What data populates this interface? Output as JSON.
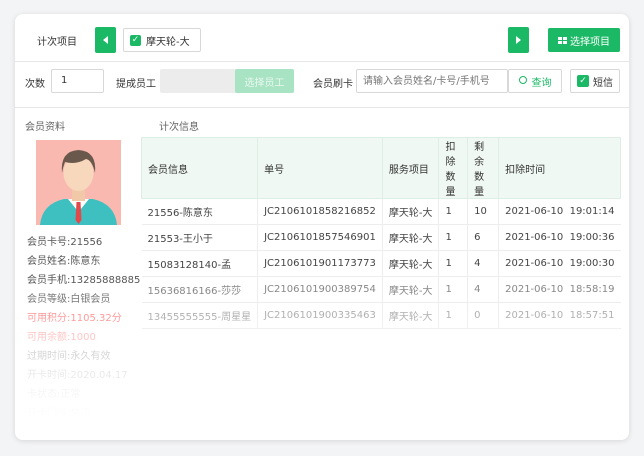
{
  "top": {
    "label": "计次项目",
    "selected_item": "摩天轮-大",
    "select_button": "选择项目"
  },
  "form": {
    "count_label": "次数",
    "count_value": "1",
    "staff_label": "提成员工",
    "staff_button": "选择员工",
    "card_label": "会员刷卡",
    "search_placeholder": "请输入会员姓名/卡号/手机号",
    "search_button": "查询",
    "sms_label": "短信"
  },
  "sections": {
    "member_title": "会员资料",
    "count_title": "计次信息"
  },
  "member": {
    "lines": [
      "会员卡号:21556",
      "会员姓名:陈意东",
      "会员手机:13285888885",
      "会员等级:白银会员",
      "可用积分:1105.32分",
      "可用余额:1000",
      "过期时间:永久有效",
      "开卡时间:2020.04.17",
      "卡状态:正常",
      "开卡门店:总店"
    ]
  },
  "table": {
    "headers": [
      "会员信息",
      "单号",
      "服务项目",
      "扣除数量",
      "剩余数量",
      "扣除时间"
    ],
    "rows": [
      [
        "21556-陈意东",
        "JC2106101858216852",
        "摩天轮-大",
        "1",
        "10",
        "2021-06-10  19:01:14"
      ],
      [
        "21553-王小于",
        "JC2106101857546901",
        "摩天轮-大",
        "1",
        "6",
        "2021-06-10  19:00:36"
      ],
      [
        "15083128140-孟",
        "JC2106101901173773",
        "摩天轮-大",
        "1",
        "4",
        "2021-06-10  19:00:30"
      ],
      [
        "15636816166-莎莎",
        "JC2106101900389754",
        "摩天轮-大",
        "1",
        "4",
        "2021-06-10  18:58:19"
      ],
      [
        "13455555555-周星星",
        "JC2106101900335463",
        "摩天轮-大",
        "1",
        "0",
        "2021-06-10  18:57:51"
      ]
    ]
  },
  "colors": {
    "accent": "#1bb865",
    "highlight": "#ff6b6b"
  }
}
